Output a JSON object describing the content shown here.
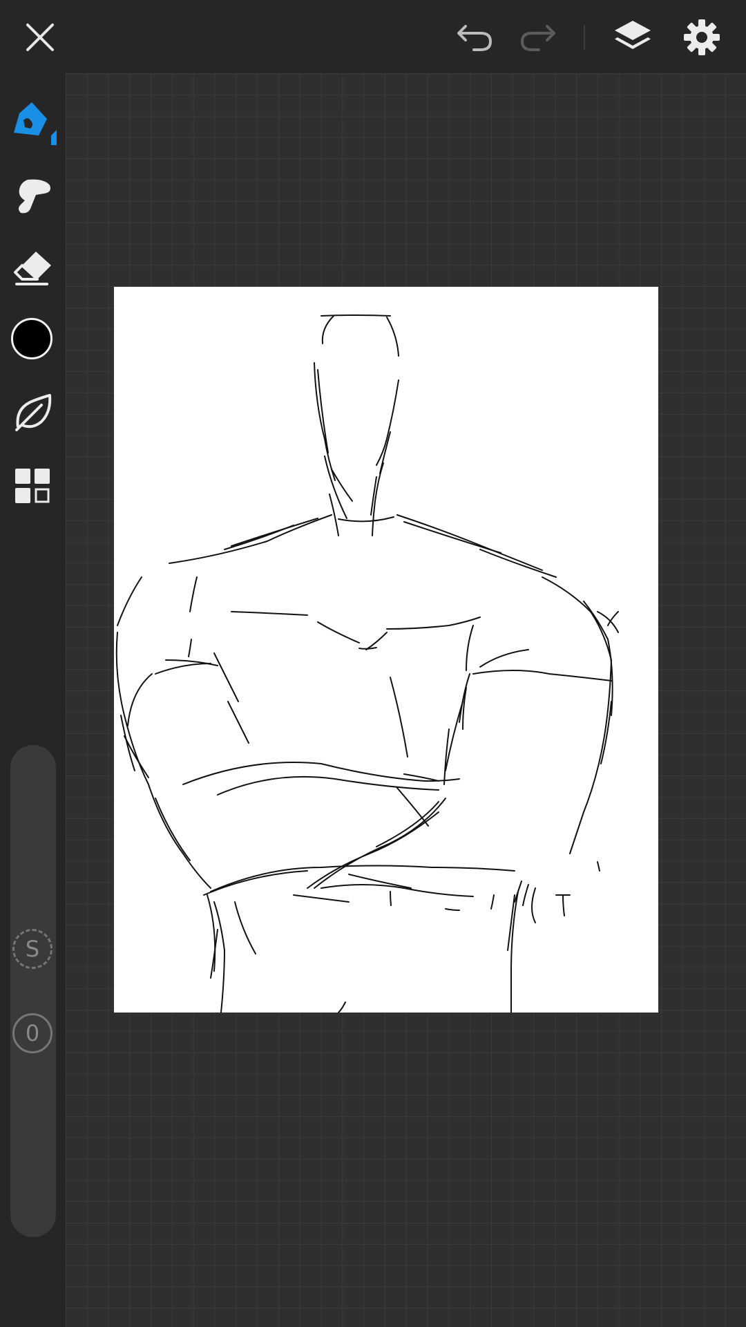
{
  "app": {
    "accent_color": "#1a8fe6",
    "current_color": "#000000"
  },
  "toolbar": {
    "close_icon": "close-icon",
    "undo_icon": "undo-icon",
    "redo_icon": "redo-icon",
    "layers_icon": "layers-icon",
    "settings_icon": "gear-icon"
  },
  "tools": [
    {
      "name": "pen",
      "icon": "pen-icon",
      "selected": true
    },
    {
      "name": "smudge",
      "icon": "smudge-icon",
      "selected": false
    },
    {
      "name": "eraser",
      "icon": "eraser-icon",
      "selected": false
    },
    {
      "name": "color",
      "icon": "color-swatch",
      "selected": false
    },
    {
      "name": "brush-library",
      "icon": "leaf-icon",
      "selected": false
    },
    {
      "name": "more",
      "icon": "grid-icon",
      "selected": false
    }
  ],
  "slider": {
    "size_badge": "S",
    "opacity_badge": "0"
  }
}
